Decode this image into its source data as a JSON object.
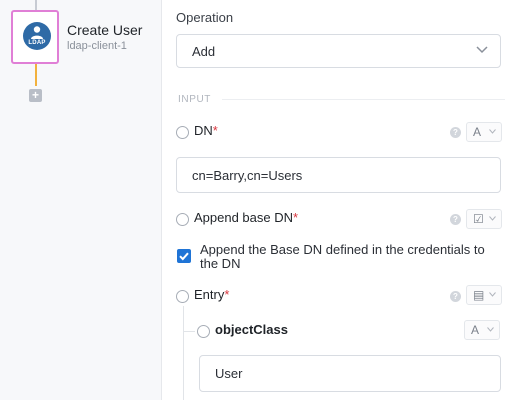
{
  "workflow_node": {
    "title": "Create User",
    "subtitle": "ldap-client-1",
    "icon_text": "LDAP",
    "icon_name": "ldap-user-icon",
    "add_step_icon": "plus-icon",
    "border_color": "#e07fd6",
    "connector_color": "#f2b13d"
  },
  "operation": {
    "label": "Operation",
    "value": "Add"
  },
  "section_label": "INPUT",
  "params": {
    "dn": {
      "label": "DN",
      "required_mark": "*",
      "type_glyph": "A",
      "value": "cn=Barry,cn=Users"
    },
    "append_base_dn": {
      "label": "Append base DN",
      "required_mark": "*",
      "type_glyph": "☑",
      "checkbox_label": "Append the Base DN defined in the credentials to the DN",
      "checked": true
    },
    "entry": {
      "label": "Entry",
      "required_mark": "*",
      "type_glyph": "▤"
    },
    "object_class": {
      "label": "objectClass",
      "type_glyph": "A",
      "value": "User"
    }
  },
  "help_glyph": "?",
  "colors": {
    "accent": "#1f74d6",
    "required": "#d9363e",
    "ldap_icon_bg": "#2e6aa6"
  }
}
